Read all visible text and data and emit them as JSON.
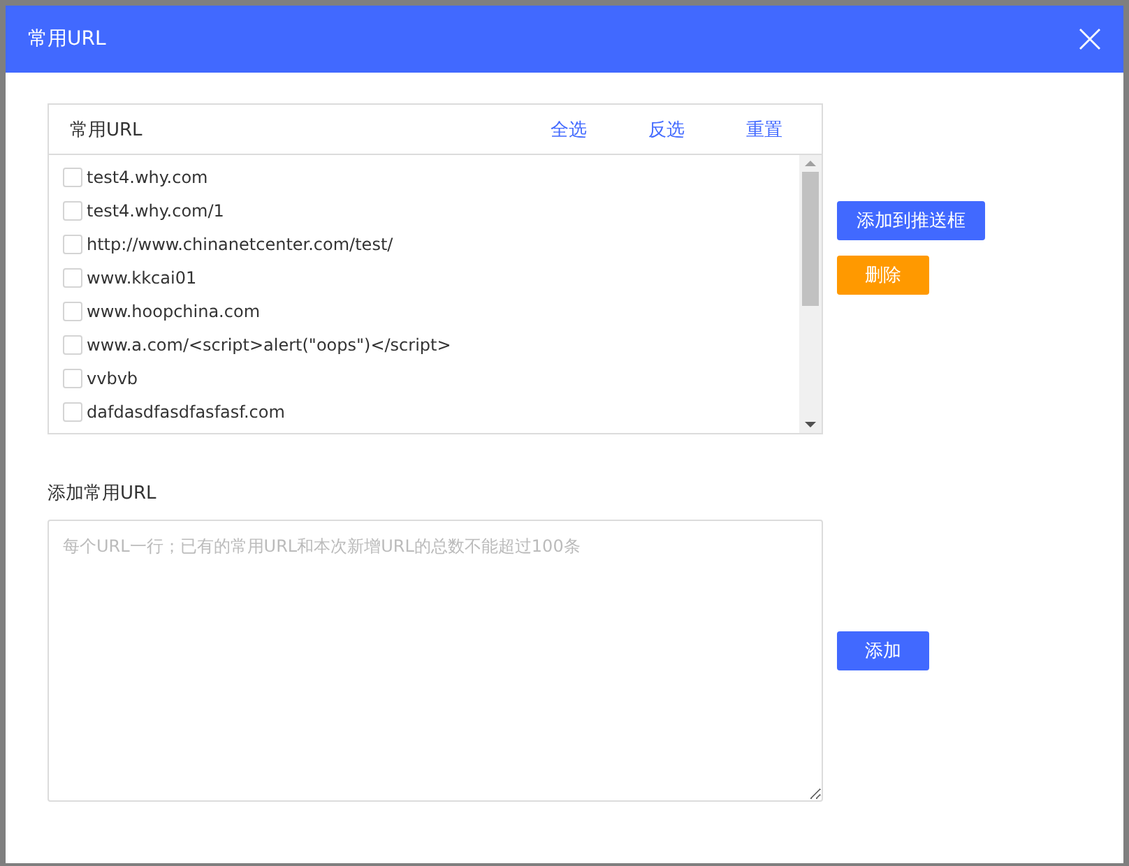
{
  "dialog": {
    "title": "常用URL"
  },
  "url_list": {
    "title": "常用URL",
    "actions": [
      "全选",
      "反选",
      "重置"
    ],
    "items": [
      {
        "label": "test4.why.com",
        "checked": false
      },
      {
        "label": "test4.why.com/1",
        "checked": false
      },
      {
        "label": "http://www.chinanetcenter.com/test/",
        "checked": false
      },
      {
        "label": "www.kkcai01",
        "checked": false
      },
      {
        "label": "www.hoopchina.com",
        "checked": false
      },
      {
        "label": "www.a.com/<script>alert(\"oops\")</script>",
        "checked": false
      },
      {
        "label": "vvbvb",
        "checked": false
      },
      {
        "label": "dafdasdfasdfasfasf.com",
        "checked": false
      }
    ]
  },
  "list_buttons": [
    {
      "label": "添加到推送框",
      "kind": "primary"
    },
    {
      "label": "删除",
      "kind": "warning"
    }
  ],
  "add_section": {
    "label": "添加常用URL",
    "placeholder": "每个URL一行；已有的常用URL和本次新增URL的总数不能超过100条",
    "button": "添加"
  }
}
